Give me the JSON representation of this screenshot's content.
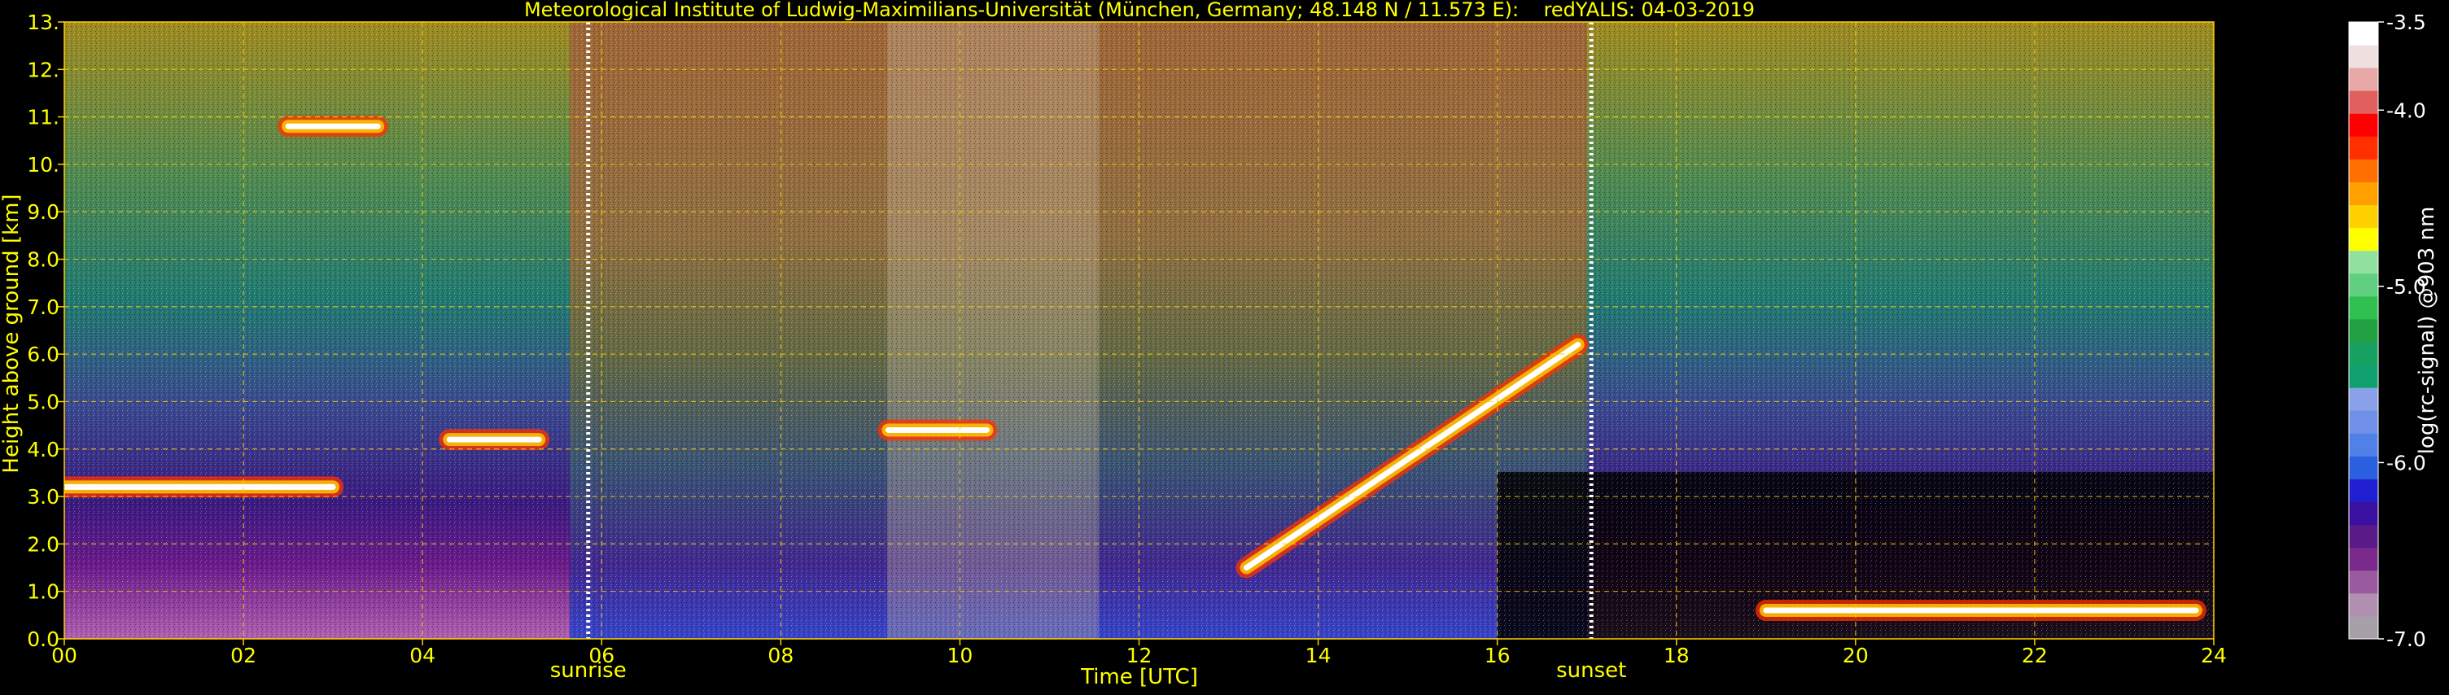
{
  "chart_data": {
    "type": "heatmap",
    "title": "Meteorological Institute of Ludwig-Maximilians-Universität (München, Germany; 48.148 N / 11.573 E):    redYALIS: 04-03-2019",
    "xlabel": "Time [UTC]",
    "ylabel": "Height above ground [km]",
    "xlim": [
      0,
      24
    ],
    "ylim": [
      0,
      13
    ],
    "x_ticks": [
      "00",
      "02",
      "04",
      "06",
      "08",
      "10",
      "12",
      "14",
      "16",
      "18",
      "20",
      "22",
      "24"
    ],
    "y_ticks": [
      "0.0",
      "1.0",
      "2.0",
      "3.0",
      "4.0",
      "5.0",
      "6.0",
      "7.0",
      "8.0",
      "9.0",
      "10.",
      "11.",
      "12.",
      "13."
    ],
    "grid": true,
    "annotations": [
      {
        "text": "sunrise",
        "x": 5.85
      },
      {
        "text": "sunset",
        "x": 17.05
      }
    ],
    "colorbar": {
      "label": "log(rc-signal) @903 nm",
      "range": [
        -7.0,
        -3.5
      ],
      "ticks": [
        "-3.5",
        "-4.0",
        "-5.0",
        "-6.0",
        "-7.0"
      ],
      "colors": [
        "#a8a0a8",
        "#b090b0",
        "#9a5aa0",
        "#7a2a8a",
        "#5a1a88",
        "#3a10a0",
        "#2020d0",
        "#2a60e0",
        "#5080e8",
        "#7090e8",
        "#8aa0e8",
        "#10a070",
        "#18a060",
        "#20a040",
        "#30c050",
        "#60d080",
        "#90e0a0",
        "#ffff00",
        "#ffd000",
        "#ffa000",
        "#ff7000",
        "#ff3000",
        "#ff0000",
        "#e06060",
        "#e8a8a8",
        "#f0e0e0",
        "#ffffff"
      ]
    },
    "features": {
      "cloud_layers": [
        {
          "start": 0.0,
          "end": 3.0,
          "height_km": 3.2
        },
        {
          "start": 2.5,
          "end": 3.5,
          "height_km": 10.8
        },
        {
          "start": 4.3,
          "end": 5.3,
          "height_km": 4.2
        },
        {
          "start": 9.2,
          "end": 10.3,
          "height_km": 4.4
        },
        {
          "start": 13.2,
          "end": 16.9,
          "height_km_start": 1.5,
          "height_km_end": 6.2
        },
        {
          "start": 19.0,
          "end": 23.8,
          "height_km": 0.6
        }
      ]
    }
  }
}
